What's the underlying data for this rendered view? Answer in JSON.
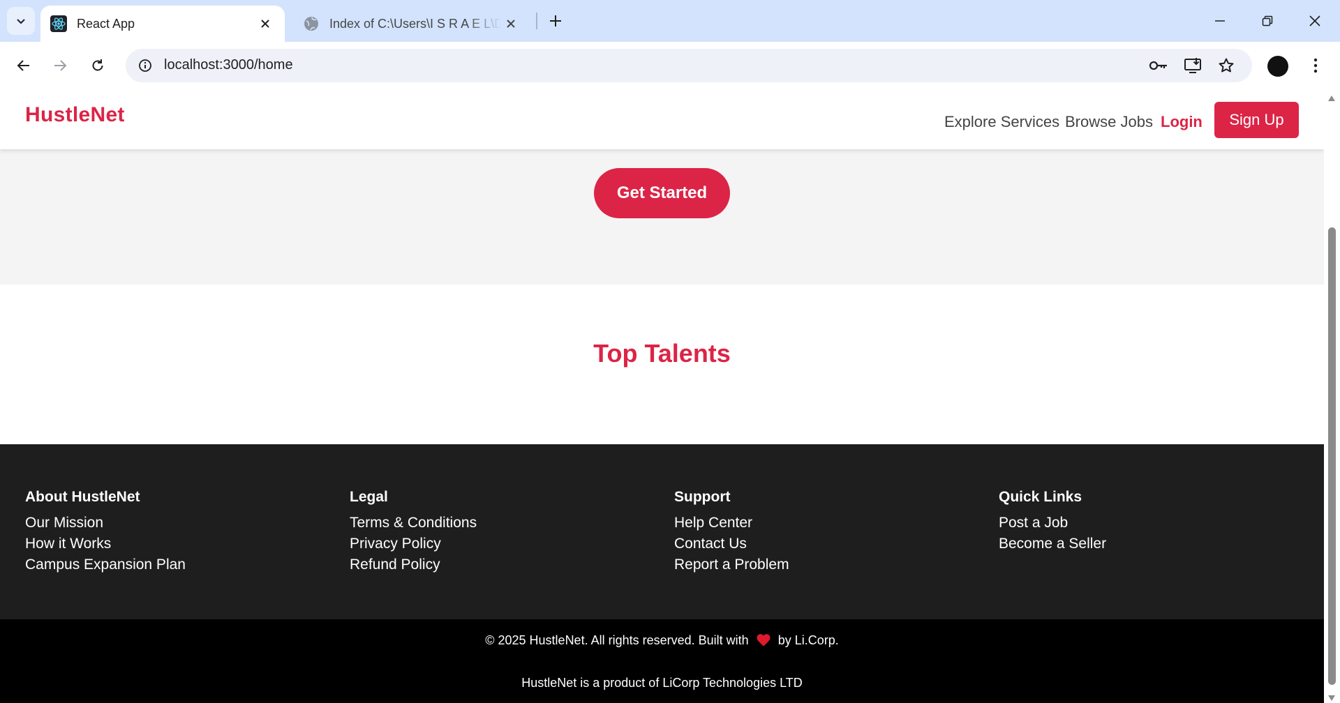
{
  "browser": {
    "tabs": [
      {
        "title": "React App",
        "icon": "react-icon",
        "active": true
      },
      {
        "title": "Index of C:\\Users\\I S R A E L\\Desktop",
        "icon": "globe-icon",
        "active": false
      }
    ],
    "url": "localhost:3000/home"
  },
  "site": {
    "logo": "HustleNet",
    "nav": {
      "explore": "Explore Services",
      "browse": "Browse Jobs",
      "login": "Login",
      "signup": "Sign Up"
    },
    "hero": {
      "cta": "Get Started"
    },
    "talents": {
      "title": "Top Talents"
    },
    "footer": {
      "columns": [
        {
          "title": "About HustleNet",
          "links": [
            "Our Mission",
            "How it Works",
            "Campus Expansion Plan"
          ]
        },
        {
          "title": "Legal",
          "links": [
            "Terms & Conditions",
            "Privacy Policy",
            "Refund Policy"
          ]
        },
        {
          "title": "Support",
          "links": [
            "Help Center",
            "Contact Us",
            "Report a Problem"
          ]
        },
        {
          "title": "Quick Links",
          "links": [
            "Post a Job",
            "Become a Seller"
          ]
        }
      ],
      "copyright_pre": "© 2025 HustleNet. All rights reserved. Built with",
      "copyright_post": "by Li.Corp.",
      "product": "HustleNet is a product of LiCorp Technologies LTD"
    }
  },
  "colors": {
    "brand": "#dc2446",
    "footer_bg": "#1e1e1e",
    "bottom_bg": "#000000",
    "hero_bg": "#f4f4f4"
  }
}
